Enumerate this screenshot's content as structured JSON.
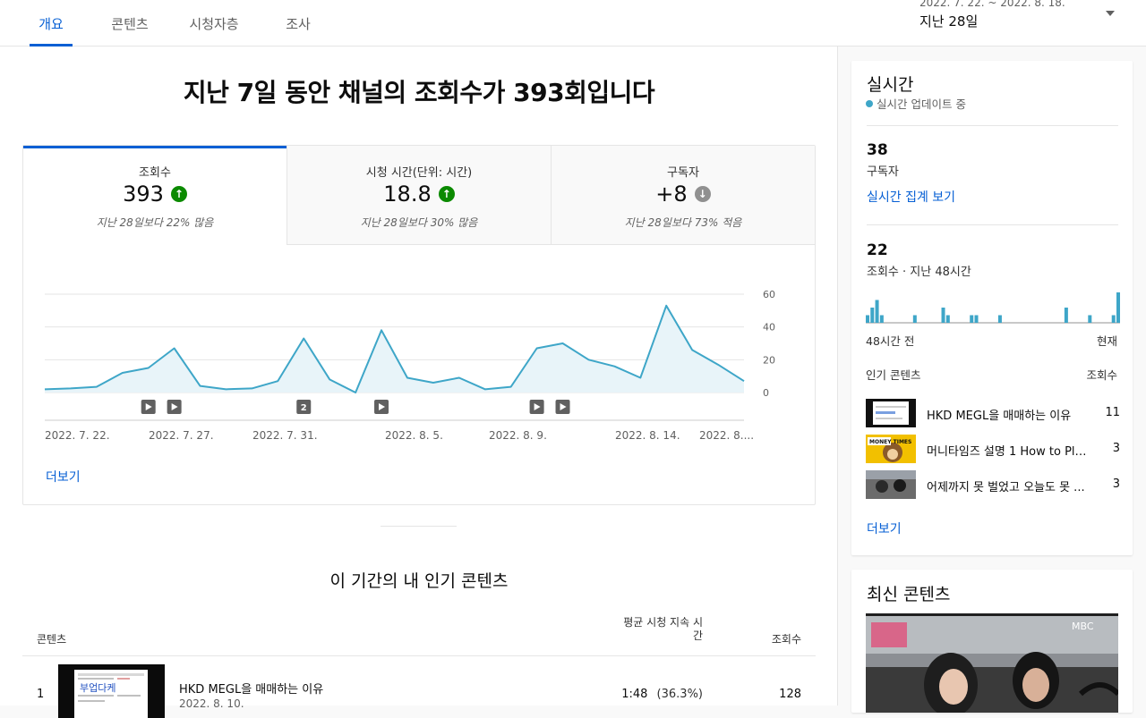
{
  "tabs": [
    {
      "label": "개요",
      "active": true
    },
    {
      "label": "콘텐츠",
      "active": false
    },
    {
      "label": "시청자층",
      "active": false
    },
    {
      "label": "조사",
      "active": false
    }
  ],
  "date_filter": {
    "range": "2022. 7. 22. ~ 2022. 8. 18.",
    "period": "지난 28일"
  },
  "headline": "지난 7일 동안 채널의 조회수가 393회입니다",
  "metrics": [
    {
      "label": "조회수",
      "value": "393",
      "trend": "up",
      "note": "지난 28일보다 22% 많음"
    },
    {
      "label": "시청 시간(단위: 시간)",
      "value": "18.8",
      "trend": "up",
      "note": "지난 28일보다 30% 많음"
    },
    {
      "label": "구독자",
      "value": "+8",
      "trend": "down",
      "note": "지난 28일보다 73% 적음"
    }
  ],
  "colors": {
    "accent": "#065fd4",
    "line": "#3ea6c8",
    "fill": "#e8f4f9",
    "up": "#0b8a00",
    "down": "#909090"
  },
  "chart_data": {
    "type": "area",
    "x": [
      "2022. 7. 22.",
      "7. 23.",
      "7. 24.",
      "7. 25.",
      "7. 26.",
      "7. 27.",
      "7. 28.",
      "7. 29.",
      "7. 30.",
      "7. 31.",
      "8. 1.",
      "8. 2.",
      "8. 3.",
      "8. 4.",
      "8. 5.",
      "8. 6.",
      "8. 7.",
      "8. 8.",
      "8. 9.",
      "8. 10.",
      "8. 11.",
      "8. 12.",
      "8. 13.",
      "8. 14.",
      "8. 15.",
      "8. 16.",
      "8. 17.",
      "8. 18."
    ],
    "series": [
      {
        "values": [
          2,
          2.5,
          3.5,
          12,
          15,
          27,
          4,
          2,
          2.5,
          7,
          33,
          8,
          0,
          38,
          9,
          6,
          9,
          2,
          3.5,
          27,
          30,
          20,
          16,
          9,
          53,
          26,
          17,
          7
        ]
      }
    ],
    "ylim": [
      0,
      60
    ],
    "yticks": [
      "60",
      "40",
      "20",
      "0"
    ],
    "xtick_labels": [
      "2022. 7. 22.",
      "2022. 7. 27.",
      "2022. 7. 31.",
      "2022. 8. 5.",
      "2022. 8. 9.",
      "2022. 8. 14.",
      "2022. 8...."
    ],
    "markers": [
      {
        "date": "7. 26.",
        "label": ""
      },
      {
        "date": "7. 27.",
        "label": ""
      },
      {
        "date": "8. 1.",
        "label": "2"
      },
      {
        "date": "8. 4.",
        "label": ""
      },
      {
        "date": "8. 10.",
        "label": ""
      },
      {
        "date": "8. 11.",
        "label": ""
      }
    ],
    "grid": true
  },
  "more_link": "더보기",
  "top_content": {
    "title": "이 기간의 내 인기 콘텐츠",
    "col_content": "콘텐츠",
    "col_avd_line1": "평균 시청 지속 시",
    "col_avd_line2": "간",
    "col_views": "조회수",
    "rows": [
      {
        "rank": "1",
        "title": "HKD MEGL을 매매하는 이유",
        "date": "2022. 8. 10.",
        "avd": "1:48",
        "avd_pct": "(36.3%)",
        "views": "128"
      }
    ]
  },
  "realtime": {
    "title": "실시간",
    "status": "실시간 업데이트 중",
    "subs_value": "38",
    "subs_label": "구독자",
    "subs_link": "실시간 집계 보기",
    "views_value": "22",
    "views_label": "조회수 · 지난 48시간",
    "hourly_views": [
      1,
      2,
      3,
      1,
      0,
      0,
      0,
      0,
      0,
      0,
      1,
      0,
      0,
      0,
      0,
      0,
      2,
      1,
      0,
      0,
      0,
      0,
      1,
      1,
      0,
      0,
      0,
      0,
      1,
      0,
      0,
      0,
      0,
      0,
      0,
      0,
      0,
      0,
      0,
      0,
      0,
      0,
      2,
      0,
      0,
      0,
      0,
      1,
      0,
      0,
      0,
      0,
      1,
      4
    ],
    "axis_left": "48시간 전",
    "axis_right": "현재",
    "popular_label": "인기 콘텐츠",
    "popular_col": "조회수",
    "popular": [
      {
        "title": "HKD MEGL을 매매하는 이유",
        "views": "11"
      },
      {
        "title": "머니타임즈 설명 1 How to Pla...",
        "views": "3"
      },
      {
        "title": "어제까지 못 벌었고 오늘도 못 ...",
        "views": "3"
      }
    ],
    "more": "더보기"
  },
  "latest": {
    "title": "최신 콘텐츠"
  },
  "thumbnail_texts": {
    "big": "부업다케",
    "monkey": "MONEY TIMES",
    "mbc": "MBC"
  }
}
